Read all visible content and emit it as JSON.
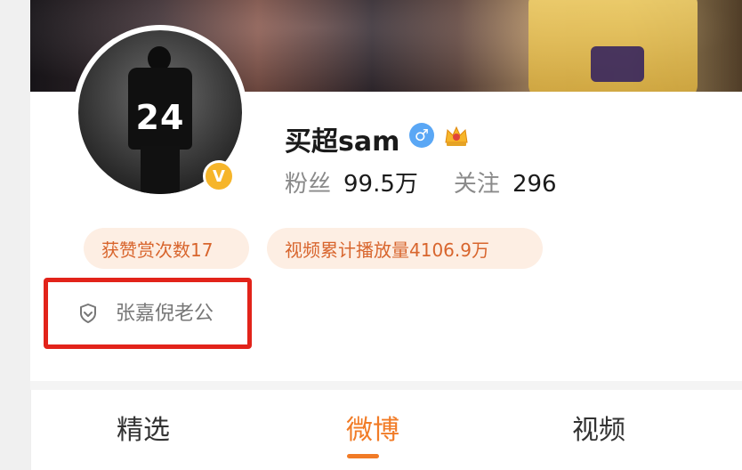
{
  "profile": {
    "name": "买超sam",
    "gender_symbol": "♂",
    "verified_symbol": "V",
    "jersey_number": "24",
    "followers_label": "粉丝",
    "followers_value": "99.5万",
    "following_label": "关注",
    "following_value": "296"
  },
  "tags": [
    {
      "label": "获赞赏次数17"
    },
    {
      "label": "视频累计播放量4106.9万"
    }
  ],
  "medal": {
    "label": "张嘉倪老公"
  },
  "tabs": [
    {
      "label": "精选"
    },
    {
      "label": "微博",
      "active": true
    },
    {
      "label": "视频"
    }
  ],
  "colors": {
    "accent": "#f17b26",
    "tag_text": "#d8652d",
    "tag_bg": "#fdeee3",
    "highlight_box": "#e2231a",
    "gender_badge": "#5aa7f5",
    "verified_badge": "#f6b52a"
  },
  "icons": {
    "gender": "male-icon",
    "crown": "crown-icon",
    "verified": "verified-badge-icon",
    "medal": "shield-icon"
  }
}
